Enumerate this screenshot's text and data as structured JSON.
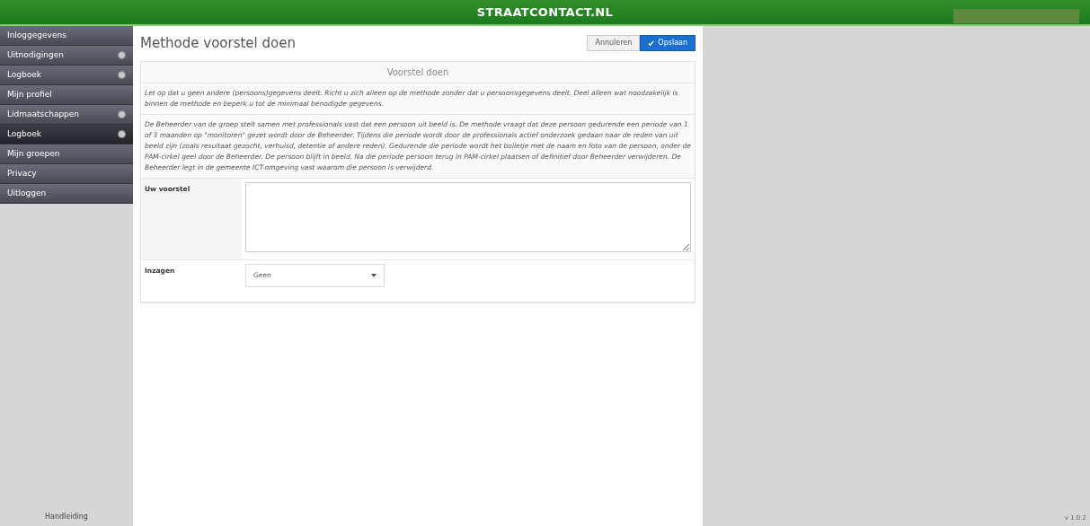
{
  "header": {
    "title": "STRAATCONTACT.NL"
  },
  "sidebar": {
    "items": [
      {
        "label": "Inloggegevens",
        "badge": false,
        "selected": false
      },
      {
        "label": "Uitnodigingen",
        "badge": true,
        "selected": false
      },
      {
        "label": "Logboek",
        "badge": true,
        "selected": false
      },
      {
        "label": "Mijn profiel",
        "badge": false,
        "selected": false
      },
      {
        "label": "Lidmaatschappen",
        "badge": true,
        "selected": false
      },
      {
        "label": "Logboek",
        "badge": true,
        "selected": true
      },
      {
        "label": "Mijn groepen",
        "badge": false,
        "selected": false
      },
      {
        "label": "Privacy",
        "badge": false,
        "selected": false
      },
      {
        "label": "Uitloggen",
        "badge": false,
        "selected": false
      }
    ],
    "footer": "Handleiding"
  },
  "page": {
    "title": "Methode voorstel doen",
    "buttons": [
      {
        "label": "Annuleren",
        "kind": "default"
      },
      {
        "label": "Opslaan",
        "kind": "primary"
      }
    ],
    "panel": {
      "heading": "Voorstel doen",
      "paragraphs": [
        "Let op dat u geen andere (persoons)gegevens deelt. Richt u zich alleen op de methode zonder dat u persoonsgegevens deelt. Deel alleen wat noodzakelijk is binnen de methode en beperk u tot de minimaal benodigde gegevens.",
        "De Beheerder van de groep stelt samen met professionals vast dat een persoon uit beeld is. De methode vraagt dat deze persoon gedurende een periode van 1 of 3 maanden op \"monitoren\" gezet wordt door de Beheerder. Tijdens die periode wordt door de professionals actief onderzoek gedaan naar de reden van uit beeld zijn (zoals resultaat gezocht, verhuisd, detentie of andere reden). Gedurende die periode wordt het bolletje met de naam en foto van de persoon, onder de PAM-cirkel geel door de Beheerder. De persoon blijft in beeld. Na die periode persoon terug in PAM-cirkel plaatsen of definitief door Beheerder verwijderen. De Beheerder legt in de gemeente ICT-omgeving vast waarom die persoon is verwijderd."
      ],
      "fields": [
        {
          "label": "Uw voorstel",
          "kind": "textarea"
        },
        {
          "label": "Inzagen",
          "kind": "select",
          "value": "Geen"
        }
      ]
    }
  },
  "version": "v 1.0.2"
}
